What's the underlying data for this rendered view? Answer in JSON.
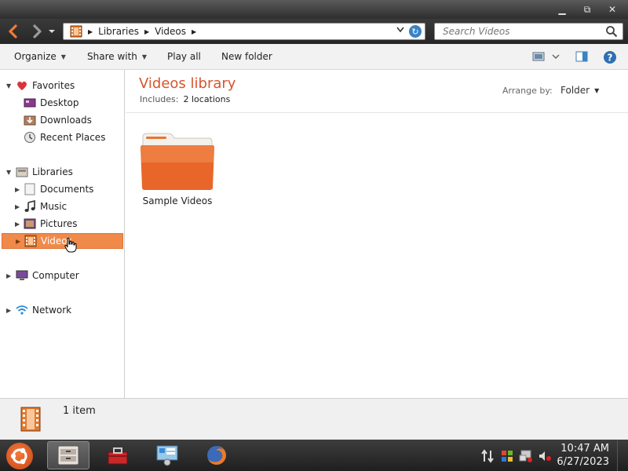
{
  "window": {
    "minimize_glyph": "▁",
    "maximize_glyph": "⧉",
    "close_glyph": "✕"
  },
  "address": {
    "crumbs": [
      "Libraries",
      "Videos"
    ],
    "search_placeholder": "Search Videos"
  },
  "toolbar": {
    "organize": "Organize",
    "share_with": "Share with",
    "play_all": "Play all",
    "new_folder": "New folder"
  },
  "sidebar": {
    "favorites": "Favorites",
    "desktop": "Desktop",
    "downloads": "Downloads",
    "recent_places": "Recent Places",
    "libraries": "Libraries",
    "documents": "Documents",
    "music": "Music",
    "pictures": "Pictures",
    "videos": "Videos",
    "computer": "Computer",
    "network": "Network"
  },
  "content": {
    "title": "Videos library",
    "includes_label": "Includes:",
    "includes_value": "2 locations",
    "arrange_label": "Arrange by:",
    "arrange_value": "Folder",
    "items": [
      {
        "name": "Sample Videos",
        "icon": "folder-icon"
      }
    ]
  },
  "status": {
    "count": "1 item"
  },
  "taskbar": {
    "time": "10:47 AM",
    "date": "6/27/2023"
  },
  "colors": {
    "accent": "#f08a4b",
    "title": "#d8542c",
    "folder": "#e8662a"
  }
}
